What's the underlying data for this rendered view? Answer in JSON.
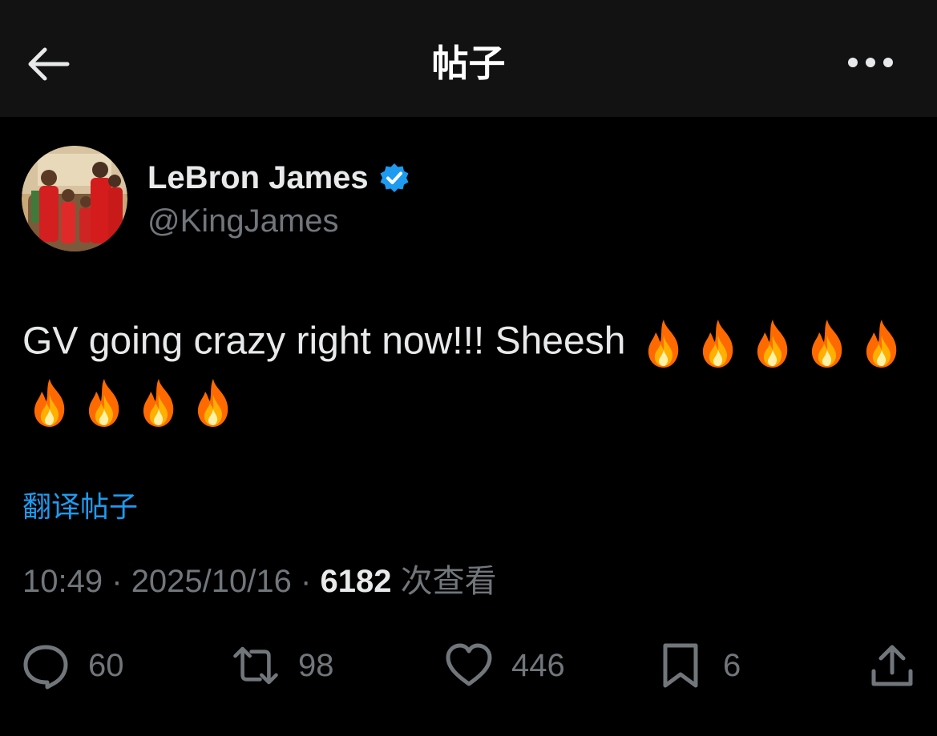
{
  "header": {
    "title": "帖子",
    "back_icon": "arrow-left-icon",
    "more_icon": "more-horizontal-icon"
  },
  "author": {
    "name": "LeBron James",
    "handle": "@KingJames",
    "verified_icon": "verified-badge-icon",
    "verified_color": "#1d9bf0"
  },
  "post": {
    "text": "GV going crazy right now!!! Sheesh",
    "emoji": "🔥",
    "emoji_count": 9,
    "translate_label": "翻译帖子"
  },
  "meta": {
    "time": "10:49",
    "date": "2025/10/16",
    "separator": "·",
    "views_count": "6182",
    "views_label": "次查看"
  },
  "actions": {
    "replies": {
      "icon": "reply-icon",
      "count": "60"
    },
    "reposts": {
      "icon": "repost-icon",
      "count": "98"
    },
    "likes": {
      "icon": "heart-icon",
      "count": "446"
    },
    "bookmarks": {
      "icon": "bookmark-icon",
      "count": "6"
    },
    "share": {
      "icon": "share-icon"
    }
  },
  "colors": {
    "background": "#000000",
    "header_background": "#121212",
    "primary_text": "#e7e9ea",
    "secondary_text": "#71767b",
    "link": "#1d9bf0"
  }
}
